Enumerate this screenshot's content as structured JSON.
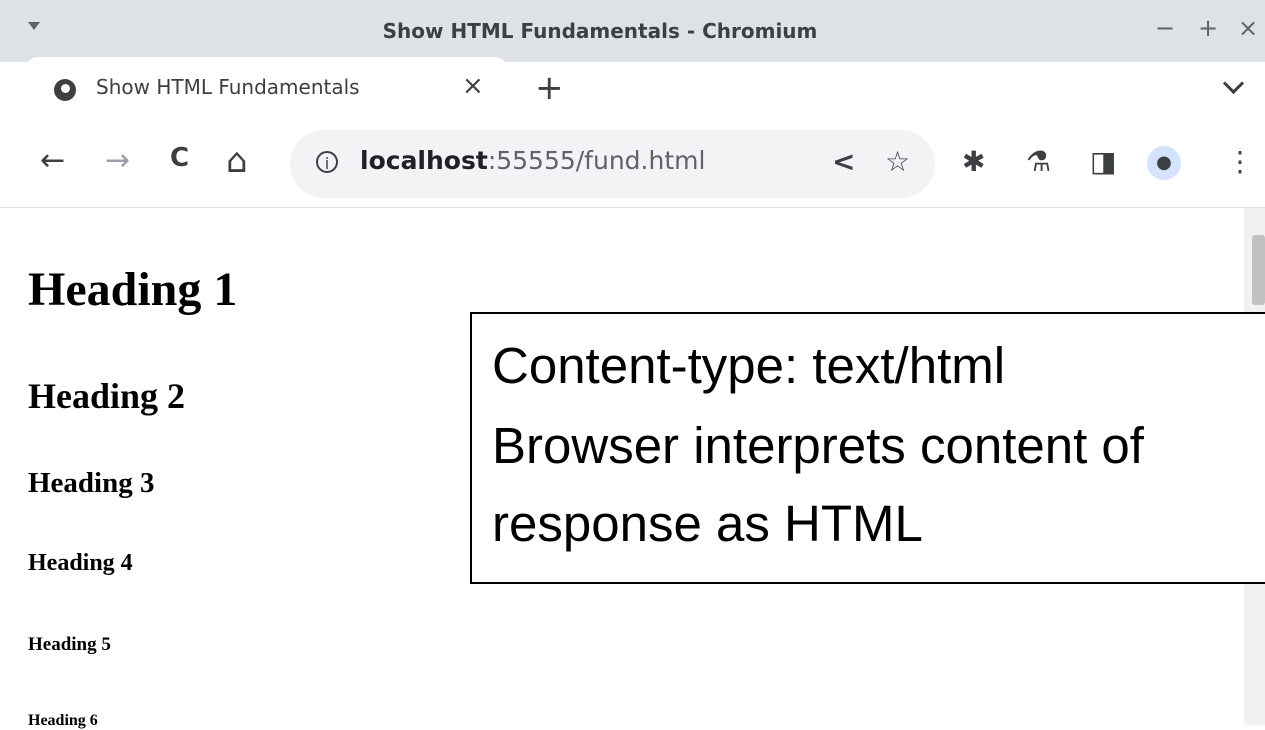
{
  "window": {
    "title": "Show HTML Fundamentals - Chromium",
    "controls": {
      "minimize": "−",
      "maximize": "+",
      "close": "×"
    }
  },
  "tab": {
    "title": "Show HTML Fundamentals",
    "close": "×",
    "new_tab": "+"
  },
  "toolbar": {
    "back": "←",
    "forward": "→",
    "reload": "C",
    "home": "⌂",
    "url_host": "localhost",
    "url_rest": ":55555/fund.html",
    "info_glyph": "i",
    "share": "<",
    "bookmark": "☆",
    "extensions": "✱",
    "labs": "⚗",
    "sidepanel": "◨",
    "profile": "●",
    "menu": "⋮"
  },
  "page": {
    "headings": [
      "Heading 1",
      "Heading 2",
      "Heading 3",
      "Heading 4",
      "Heading 5",
      "Heading 6"
    ]
  },
  "annotation": {
    "lines": [
      "Content-type: text/html",
      "Browser interprets content of",
      "response as HTML"
    ]
  },
  "colors": {
    "frame": "#dee1e6",
    "omnibox": "#f1f3f4",
    "icon": "#3c4043"
  }
}
